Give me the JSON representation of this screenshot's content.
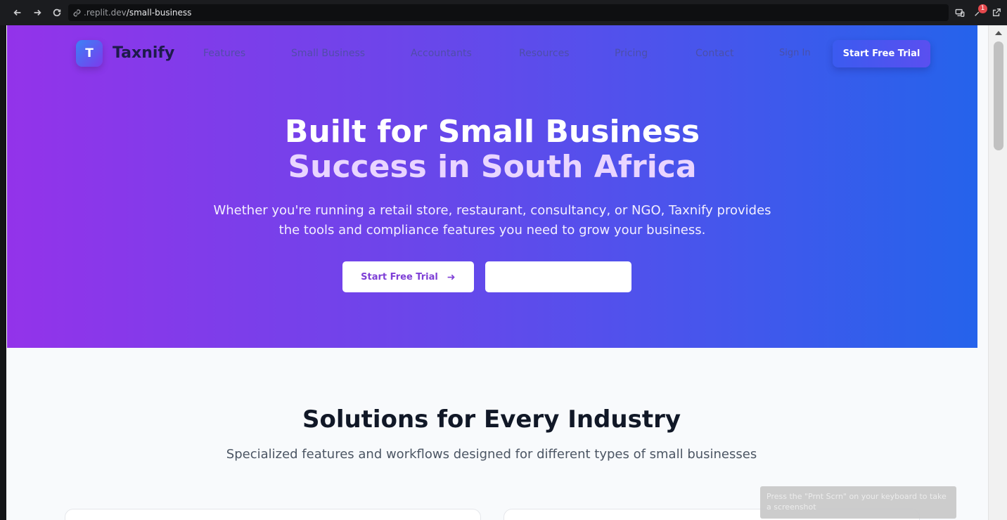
{
  "browser": {
    "url_domain": ".replit.dev",
    "url_path": "/small-business",
    "notification_count": "1"
  },
  "header": {
    "logo_letter": "T",
    "brand": "Taxnify",
    "nav": [
      "Features",
      "Small Business",
      "Accountants",
      "Resources",
      "Pricing",
      "Contact"
    ],
    "sign_in": "Sign In",
    "cta": "Start Free Trial"
  },
  "hero": {
    "title_line1": "Built for Small Business",
    "title_line2": "Success in South Africa",
    "subtitle_line1": "Whether you're running a retail store, restaurant, consultancy, or NGO, Taxnify provides",
    "subtitle_line2": "the tools and compliance features you need to grow your business.",
    "primary_button": "Start Free Trial"
  },
  "solutions": {
    "title": "Solutions for Every Industry",
    "subtitle": "Specialized features and workflows designed for different types of small businesses"
  },
  "toast": {
    "text": "Press the \"Prnt Scrn\" on your keyboard to take a screenshot"
  },
  "colors": {
    "hero_start": "#9333ea",
    "hero_end": "#2563eb",
    "accent_purple": "#7e3fd6",
    "title_light": "#e9d5ff"
  }
}
